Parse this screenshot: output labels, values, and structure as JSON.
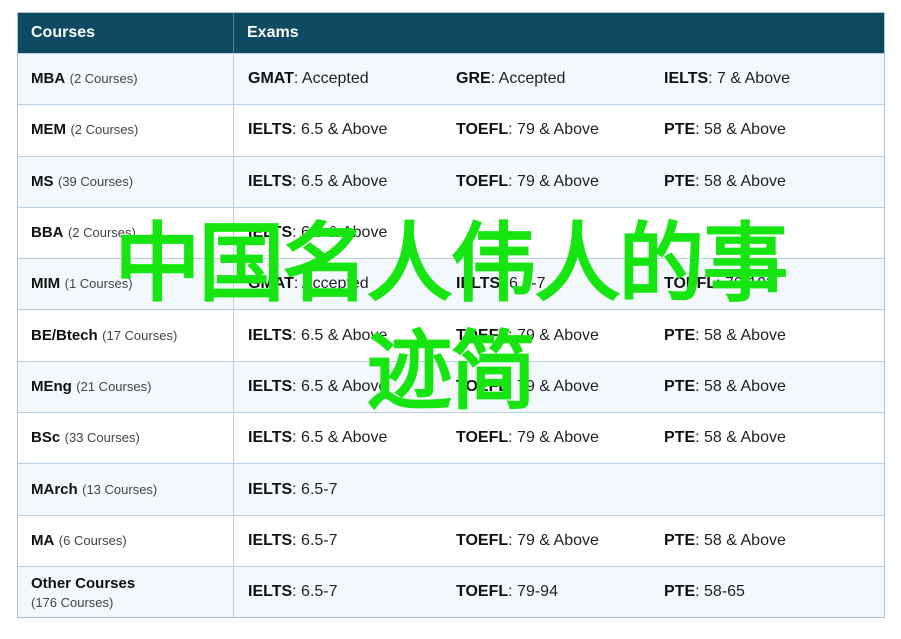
{
  "table": {
    "headers": {
      "courses": "Courses",
      "exams": "Exams"
    },
    "rows": [
      {
        "name": "MBA",
        "count": "(2 Courses)",
        "exams": [
          {
            "label": "GMAT",
            "value": ": Accepted"
          },
          {
            "label": "GRE",
            "value": ": Accepted"
          },
          {
            "label": "IELTS",
            "value": ": 7 & Above"
          }
        ]
      },
      {
        "name": "MEM",
        "count": "(2 Courses)",
        "exams": [
          {
            "label": "IELTS",
            "value": ": 6.5 & Above"
          },
          {
            "label": "TOEFL",
            "value": ": 79 & Above"
          },
          {
            "label": "PTE",
            "value": ": 58 & Above"
          }
        ]
      },
      {
        "name": "MS",
        "count": "(39 Courses)",
        "exams": [
          {
            "label": "IELTS",
            "value": ": 6.5 & Above"
          },
          {
            "label": "TOEFL",
            "value": ": 79 & Above"
          },
          {
            "label": "PTE",
            "value": ": 58 & Above"
          }
        ]
      },
      {
        "name": "BBA",
        "count": "(2 Courses)",
        "exams": [
          {
            "label": "IELTS",
            "value": ": 6.5 & Above"
          },
          {
            "label": "",
            "value": ""
          },
          {
            "label": "",
            "value": ""
          }
        ]
      },
      {
        "name": "MIM",
        "count": "(1 Courses)",
        "exams": [
          {
            "label": "GMAT",
            "value": ": Accepted"
          },
          {
            "label": "IELTS",
            "value": ": 6.5-7"
          },
          {
            "label": "TOEFL",
            "value": ": 79-102"
          }
        ]
      },
      {
        "name": "BE/Btech",
        "count": "(17 Courses)",
        "exams": [
          {
            "label": "IELTS",
            "value": ": 6.5 & Above"
          },
          {
            "label": "TOEFL",
            "value": ": 79 & Above"
          },
          {
            "label": "PTE",
            "value": ": 58 & Above"
          }
        ]
      },
      {
        "name": "MEng",
        "count": "(21 Courses)",
        "exams": [
          {
            "label": "IELTS",
            "value": ": 6.5 & Above"
          },
          {
            "label": "TOEFL",
            "value": ": 79 & Above"
          },
          {
            "label": "PTE",
            "value": ": 58 & Above"
          }
        ]
      },
      {
        "name": "BSc",
        "count": "(33 Courses)",
        "exams": [
          {
            "label": "IELTS",
            "value": ": 6.5 & Above"
          },
          {
            "label": "TOEFL",
            "value": ": 79 & Above"
          },
          {
            "label": "PTE",
            "value": ": 58 & Above"
          }
        ]
      },
      {
        "name": "MArch",
        "count": "(13 Courses)",
        "exams": [
          {
            "label": "IELTS",
            "value": ": 6.5-7"
          },
          {
            "label": "",
            "value": ""
          },
          {
            "label": "",
            "value": ""
          }
        ]
      },
      {
        "name": "MA",
        "count": "(6 Courses)",
        "exams": [
          {
            "label": "IELTS",
            "value": ": 6.5-7"
          },
          {
            "label": "TOEFL",
            "value": ": 79 & Above"
          },
          {
            "label": "PTE",
            "value": ": 58 & Above"
          }
        ]
      },
      {
        "name": "Other Courses",
        "count": "(176 Courses)",
        "exams": [
          {
            "label": "IELTS",
            "value": ": 6.5-7"
          },
          {
            "label": "TOEFL",
            "value": ": 79-94"
          },
          {
            "label": "PTE",
            "value": ": 58-65"
          }
        ]
      }
    ]
  },
  "overlay": {
    "line1": "中国名人伟人的事",
    "line2": "迹简"
  },
  "colors": {
    "header_bg": "#0f4a63",
    "overlay_text": "#17e512",
    "row_alt_bg": "#f3f8fc",
    "border": "#b8d0e2"
  }
}
